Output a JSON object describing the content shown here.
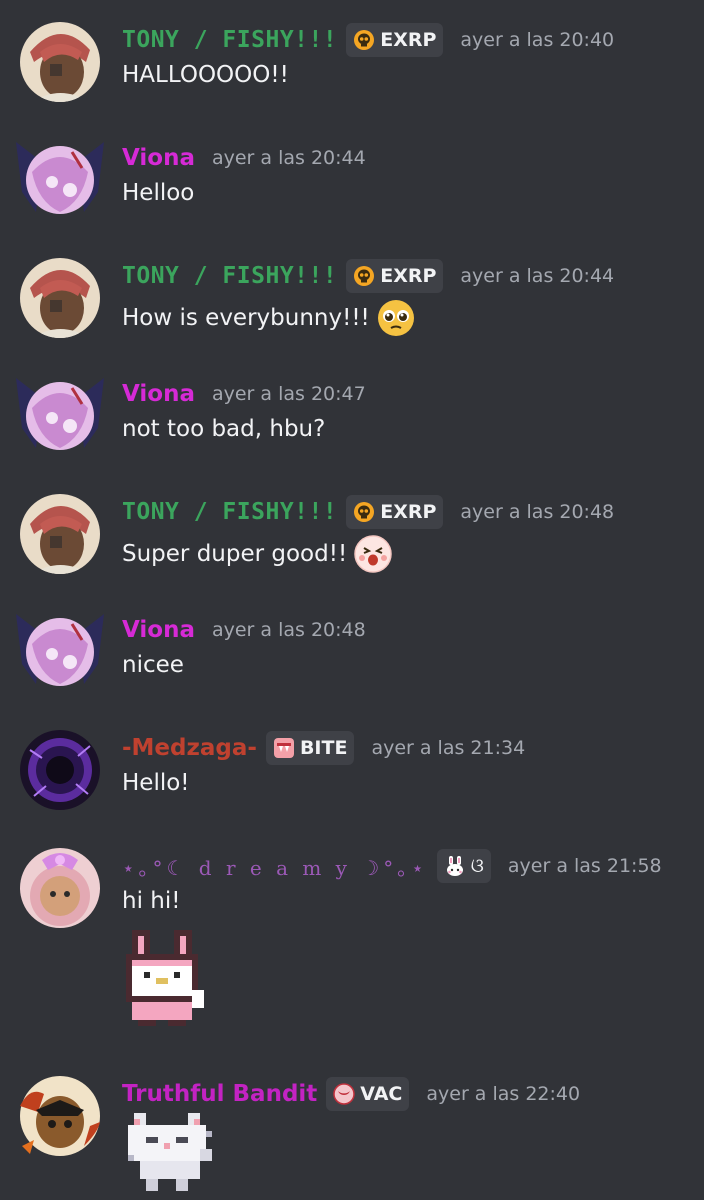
{
  "colors": {
    "background": "#313338",
    "text": "#f2f3f5",
    "timestamp": "#a4a8b0",
    "tag_bg": "#3f4147",
    "tony": "#3ba55d",
    "viona": "#d62ad6",
    "medzaga": "#c0412f",
    "dreamy": "#9b59b6",
    "truthful": "#c323c3"
  },
  "messages": [
    {
      "author": "TONY / FISHY!!!",
      "tag": "EXRP",
      "tag_icon": "skull-icon",
      "timestamp": "ayer a las 20:40",
      "text": "HALLOOOOO!!"
    },
    {
      "author": "Viona",
      "timestamp": "ayer a las 20:44",
      "text": "Helloo"
    },
    {
      "author": "TONY / FISHY!!!",
      "tag": "EXRP",
      "tag_icon": "skull-icon",
      "timestamp": "ayer a las 20:44",
      "text": "How is everybunny!!!",
      "emoji": "pleading-face-emoji"
    },
    {
      "author": "Viona",
      "timestamp": "ayer a las 20:47",
      "text": "not too bad, hbu?"
    },
    {
      "author": "TONY / FISHY!!!",
      "tag": "EXRP",
      "tag_icon": "skull-icon",
      "timestamp": "ayer a las 20:48",
      "text": "Super duper good!!",
      "emoji": "excited-face-emoji"
    },
    {
      "author": "Viona",
      "timestamp": "ayer a las 20:48",
      "text": "nicee"
    },
    {
      "author": "-Medzaga-",
      "tag": "BITE",
      "tag_icon": "fang-icon",
      "timestamp": "ayer a las 21:34",
      "text": "Hello!"
    },
    {
      "author": "⋆｡°☾ d r e a m y ☽°｡⋆",
      "tag": "ଓ",
      "tag_icon": "bunny-icon",
      "timestamp": "ayer a las 21:58",
      "text": "hi hi!",
      "sticker": "pixel-bunny-sticker"
    },
    {
      "author": "Truthful Bandit",
      "tag": "VAC",
      "tag_icon": "moon-icon",
      "timestamp": "ayer a las 22:40",
      "sticker": "pixel-cat-sticker"
    }
  ]
}
